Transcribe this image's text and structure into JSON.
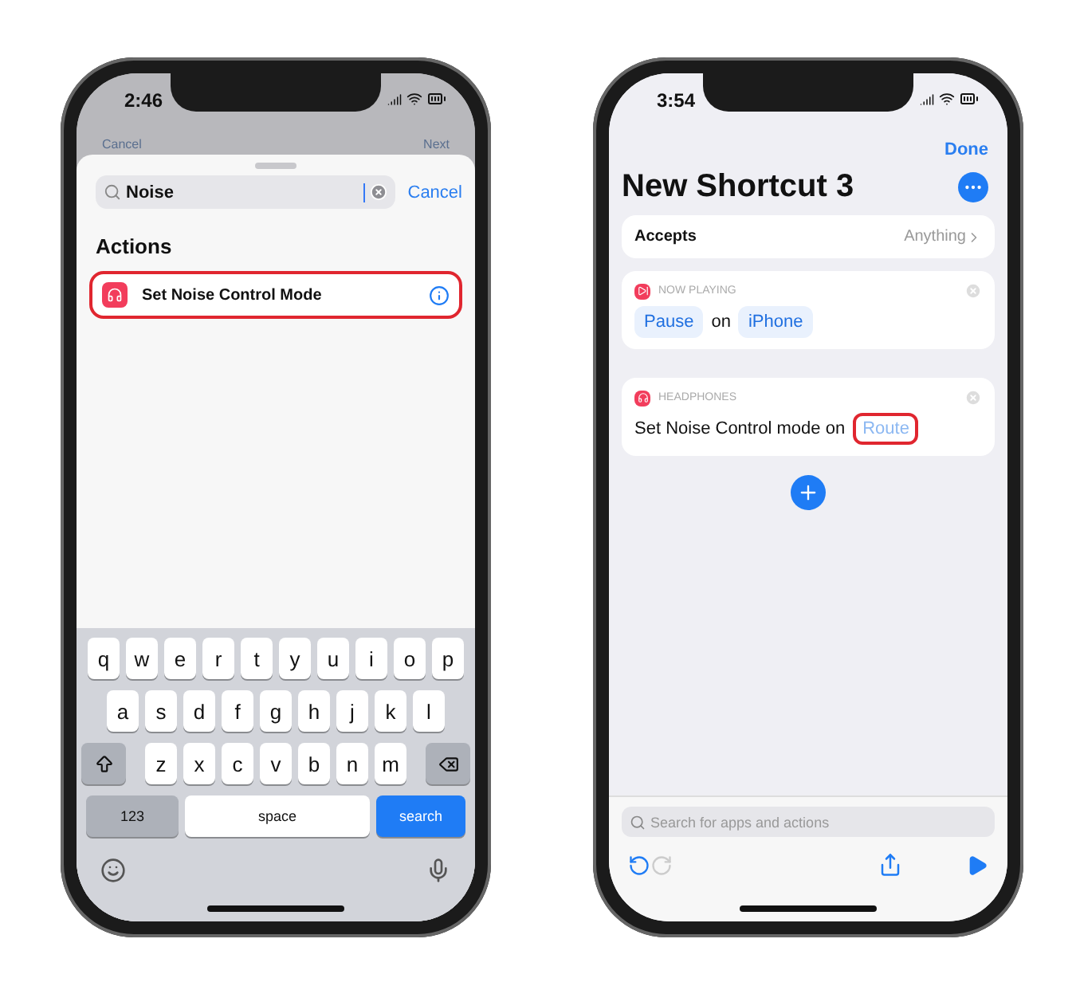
{
  "phones": [
    {
      "kind": "search",
      "status_time": "2:46",
      "backdrop_buttons": [
        "Cancel",
        "Next"
      ],
      "search": {
        "value": "Noise",
        "cancel": "Cancel"
      },
      "section_title": "Actions",
      "results": [
        {
          "label": "Set Noise Control Mode",
          "highlighted": true
        }
      ],
      "keyboard": {
        "rows": [
          [
            "q",
            "w",
            "e",
            "r",
            "t",
            "y",
            "u",
            "i",
            "o",
            "p"
          ],
          [
            "a",
            "s",
            "d",
            "f",
            "g",
            "h",
            "j",
            "k",
            "l"
          ],
          [
            "z",
            "x",
            "c",
            "v",
            "b",
            "n",
            "m"
          ]
        ],
        "numbers": "123",
        "space": "space",
        "action": "search"
      }
    },
    {
      "kind": "editor",
      "status_time": "3:54",
      "done": "Done",
      "title": "New Shortcut 3",
      "accepts": {
        "label": "Accepts",
        "value": "Anything"
      },
      "actions": [
        {
          "app": "NOW PLAYING",
          "parts": [
            {
              "text": "Pause",
              "kind": "value",
              "highlighted": false
            },
            {
              "text": "on",
              "kind": "text",
              "highlighted": false
            },
            {
              "text": "iPhone",
              "kind": "value",
              "highlighted": false
            }
          ]
        },
        {
          "app": "HEADPHONES",
          "parts": [
            {
              "text": "Set Noise Control mode on",
              "kind": "text",
              "highlighted": false
            },
            {
              "text": "Route",
              "kind": "placeholder",
              "highlighted": true
            }
          ]
        }
      ],
      "search_placeholder": "Search for apps and actions",
      "redo_enabled": false
    }
  ]
}
